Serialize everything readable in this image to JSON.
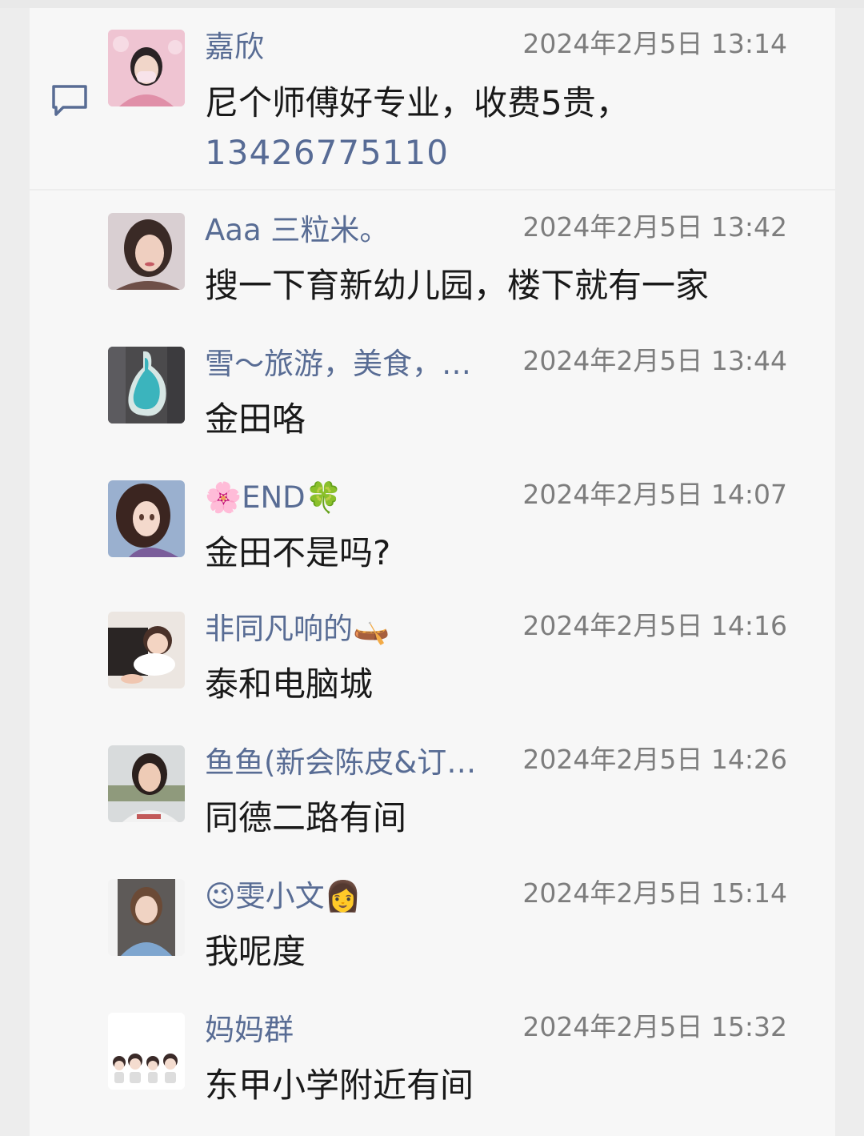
{
  "comments": [
    {
      "name": "嘉欣",
      "time": "2024年2月5日 13:14",
      "text": "尼个师傅好专业，收费5贵，",
      "link": "13426775110"
    },
    {
      "name": "Aaa 三粒米。",
      "time": "2024年2月5日 13:42",
      "text": "搜一下育新幼儿园，楼下就有一家"
    },
    {
      "name": "雪～旅游，美食，…",
      "time": "2024年2月5日 13:44",
      "text": "金田咯"
    },
    {
      "name": "🌸END🍀",
      "time": "2024年2月5日 14:07",
      "text": "金田不是吗?"
    },
    {
      "name": "非同凡响的🛶",
      "time": "2024年2月5日 14:16",
      "text": "泰和电脑城"
    },
    {
      "name": "鱼鱼(新会陈皮&订…",
      "time": "2024年2月5日 14:26",
      "text": "同德二路有间"
    },
    {
      "name": "😉雯小文👩",
      "time": "2024年2月5日 15:14",
      "text": "我呢度"
    },
    {
      "name": "妈妈群",
      "time": "2024年2月5日 15:32",
      "text": "东甲小学附近有间"
    }
  ],
  "colors": {
    "name": "#586c94",
    "link": "#576b95",
    "time": "#7d7d7d",
    "text": "#191919",
    "card": "#f7f7f7"
  },
  "icons": {
    "comment": "comment-bubble-icon"
  }
}
